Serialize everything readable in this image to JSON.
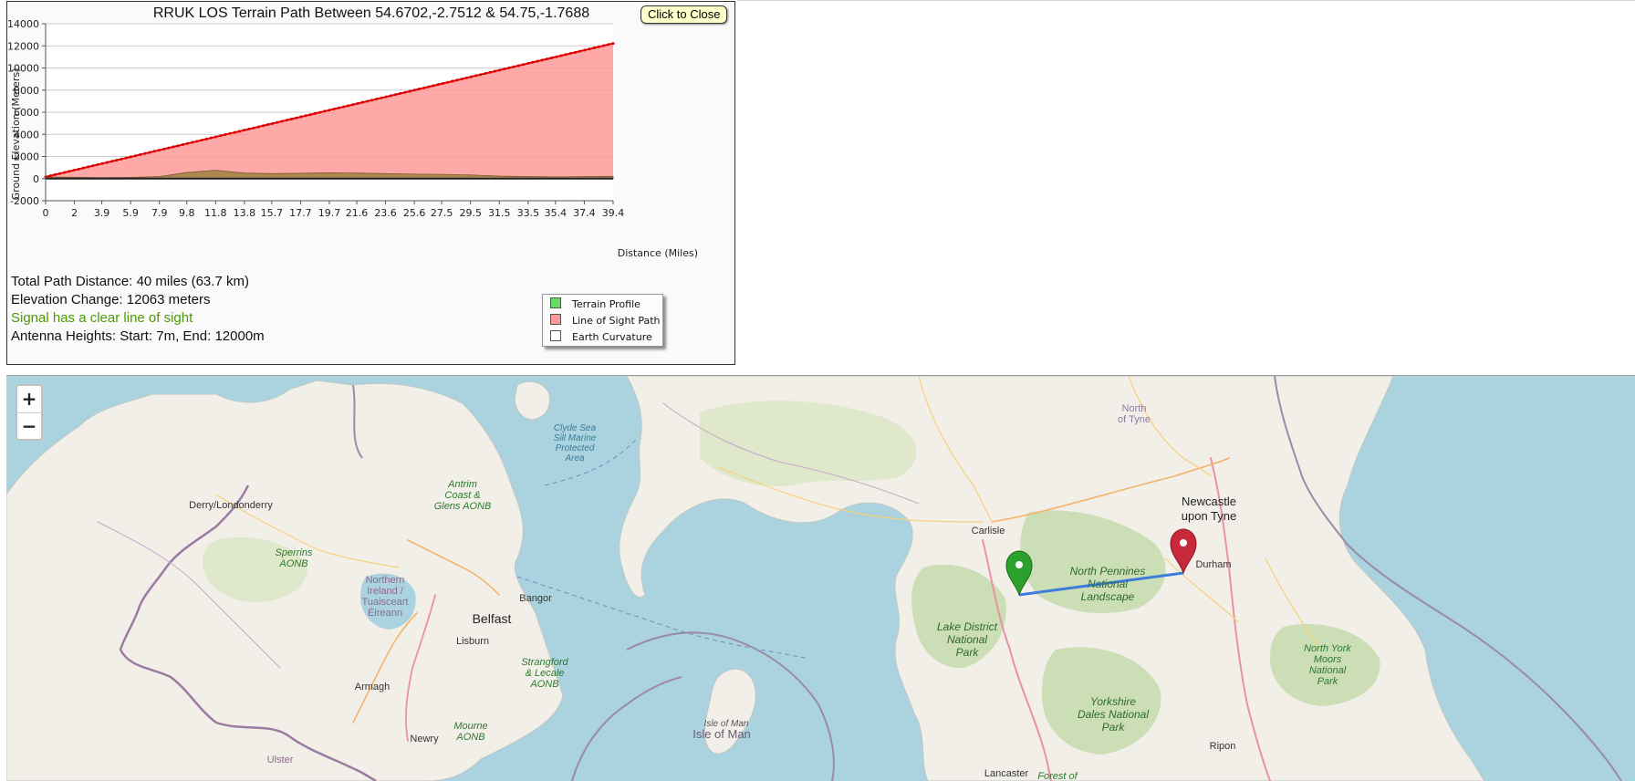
{
  "panel": {
    "title": "RRUK LOS Terrain Path Between 54.6702,-2.7512 & 54.75,-1.7688",
    "close_label": "Click to Close"
  },
  "chart_data": {
    "type": "area",
    "ylabel": "Ground Elevation (Meters)",
    "xlabel": "Distance (Miles)",
    "ylim": [
      -2000,
      14000
    ],
    "y_ticks": [
      "14000",
      "12000",
      "10000",
      "8000",
      "6000",
      "4000",
      "2000",
      "0",
      "-2000"
    ],
    "x_ticks": [
      "0",
      "2",
      "3.9",
      "5.9",
      "7.9",
      "9.8",
      "11.8",
      "13.8",
      "15.7",
      "17.7",
      "19.7",
      "21.6",
      "23.6",
      "25.6",
      "27.5",
      "29.5",
      "31.5",
      "33.5",
      "35.4",
      "37.4",
      "39.4"
    ],
    "grid": true,
    "series": [
      {
        "name": "Terrain Profile",
        "x": [
          0,
          2,
          3.9,
          5.9,
          7.9,
          9.8,
          11.8,
          13.8,
          15.7,
          17.7,
          19.7,
          21.6,
          23.6,
          25.6,
          27.5,
          29.5,
          31.5,
          33.5,
          35.4,
          37.4,
          39.4
        ],
        "values": [
          150,
          120,
          90,
          110,
          180,
          550,
          750,
          500,
          450,
          480,
          520,
          500,
          450,
          400,
          380,
          330,
          220,
          180,
          150,
          180,
          200
        ]
      },
      {
        "name": "Line of Sight Path",
        "x": [
          0,
          39.4
        ],
        "values": [
          157,
          12220
        ]
      },
      {
        "name": "Earth Curvature",
        "x": [
          0,
          39.4
        ],
        "values": [
          0,
          0
        ]
      }
    ],
    "legend": {
      "placement": "bottom-right",
      "items": [
        {
          "label": "Terrain Profile",
          "color": "#66dd66"
        },
        {
          "label": "Line of Sight Path",
          "color": "#ff9999"
        },
        {
          "label": "Earth Curvature",
          "color": "#ffffff"
        }
      ]
    },
    "colors": {
      "los_fill": "#ff9999",
      "los_line": "#dd0000",
      "terrain_fill": "#a08040"
    }
  },
  "stats": {
    "distance": "Total Path Distance: 40 miles (63.7 km)",
    "elevation": "Elevation Change: 12063 meters",
    "status": "Signal has a clear line of sight",
    "antenna": "Antenna Heights: Start: 7m, End: 12000m"
  },
  "map": {
    "zoom_in_label": "+",
    "zoom_out_label": "−",
    "start_marker_color": "#2ca02c",
    "end_marker_color": "#c8283c",
    "path_color": "#3b7ddd",
    "places": {
      "derry": "Derry/Londonderry",
      "belfast": "Belfast",
      "bangor": "Bangor",
      "lisburn": "Lisburn",
      "armagh": "Armagh",
      "newry": "Newry",
      "ulster": "Ulster",
      "carlisle": "Carlisle",
      "newcastle": "Newcastle\nupon Tyne",
      "durham": "Durham",
      "ripon": "Ripon",
      "lancaster": "Lancaster",
      "isle_of_man": "Isle of Man",
      "isle_of_man_small": "Isle of Man",
      "north_of_tyne": "North\nof Tyne"
    },
    "areas": {
      "sperrins": "Sperrins\nAONB",
      "ni_region": "Northern\nIreland /\nTuaisceart\nÉireann",
      "antrim": "Antrim\nCoast &\nGlens AONB",
      "clyde": "Clyde Sea\nSill Marine\nProtected\nArea",
      "strangford": "Strangford\n& Lecale\nAONB",
      "mourne": "Mourne\nAONB",
      "north_pennines": "North Pennines\nNational\nLandscape",
      "lake_district": "Lake District\nNational\nPark",
      "yorkshire_dales": "Yorkshire\nDales National\nPark",
      "north_york_moors": "North York\nMoors\nNational\nPark",
      "forest_of": "Forest of"
    }
  }
}
